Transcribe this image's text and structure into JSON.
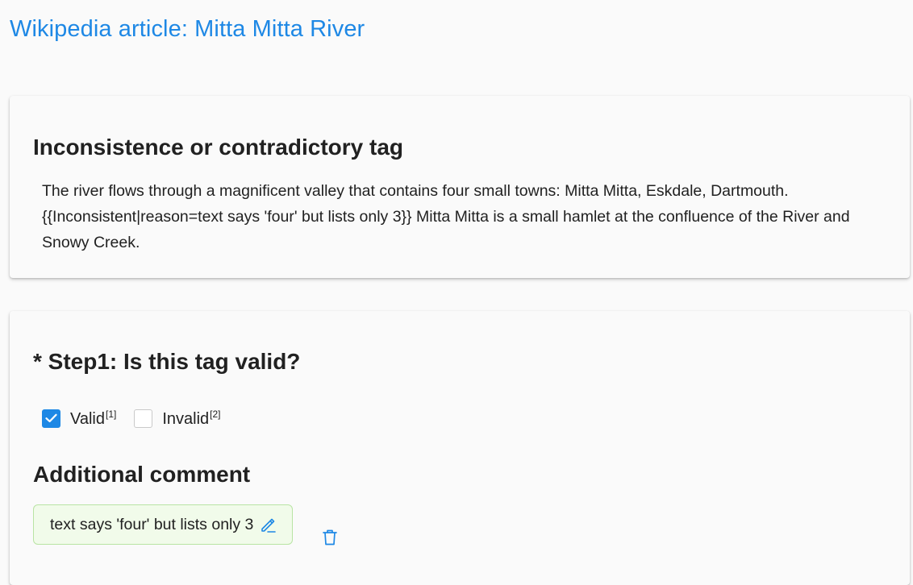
{
  "header": {
    "title": "Wikipedia article: Mitta Mitta River"
  },
  "tag_card": {
    "title": "Inconsistence or contradictory tag",
    "passage": "The river flows through a magnificent valley that contains four small towns: Mitta Mitta, Eskdale, Dartmouth. {{Inconsistent|reason=text says 'four' but lists only 3}} Mitta Mitta is a small hamlet at the confluence of the River and Snowy Creek."
  },
  "step_card": {
    "title": "* Step1: Is this tag valid?",
    "options": [
      {
        "label": "Valid",
        "shortcut": "[1]",
        "checked": true
      },
      {
        "label": "Invalid",
        "shortcut": "[2]",
        "checked": false
      }
    ],
    "comment_title": "Additional comment",
    "comment_text": "text says 'four' but lists only 3"
  },
  "colors": {
    "accent": "#1e88e5",
    "comment_bg": "#f1fbea",
    "comment_border": "#b9e4a4"
  },
  "icons": {
    "edit": "pencil-icon",
    "delete": "trash-icon",
    "check": "checkmark-icon"
  }
}
